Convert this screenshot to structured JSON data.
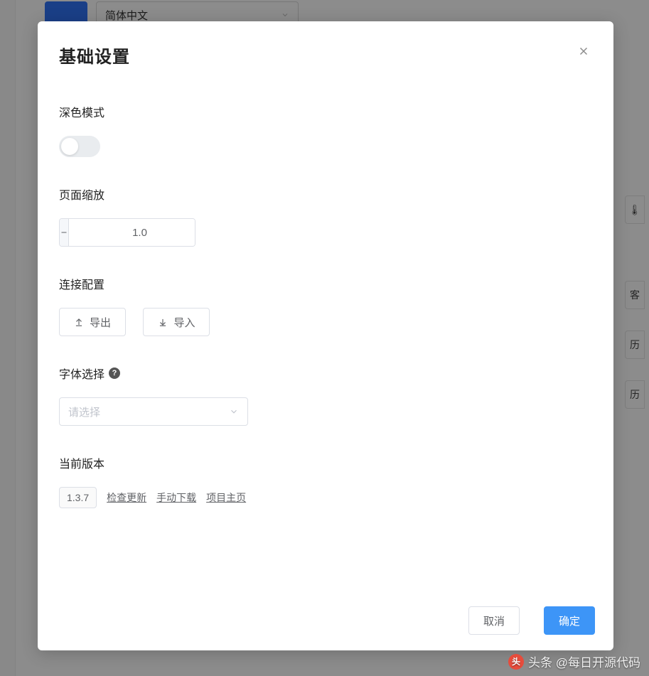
{
  "bg": {
    "lang_select_value": "简体中文"
  },
  "dialog": {
    "title": "基础设置",
    "sections": {
      "dark_mode": {
        "label": "深色模式",
        "enabled": false
      },
      "zoom": {
        "label": "页面缩放",
        "value": "1.0"
      },
      "connection": {
        "label": "连接配置",
        "export_label": "导出",
        "import_label": "导入"
      },
      "font": {
        "label": "字体选择",
        "placeholder": "请选择"
      },
      "version": {
        "label": "当前版本",
        "badge": "1.3.7",
        "links": {
          "check_update": "检查更新",
          "manual_download": "手动下载",
          "project_home": "项目主页"
        }
      }
    },
    "footer": {
      "cancel": "取消",
      "confirm": "确定"
    }
  },
  "watermark": {
    "text": "头条 @每日开源代码"
  }
}
